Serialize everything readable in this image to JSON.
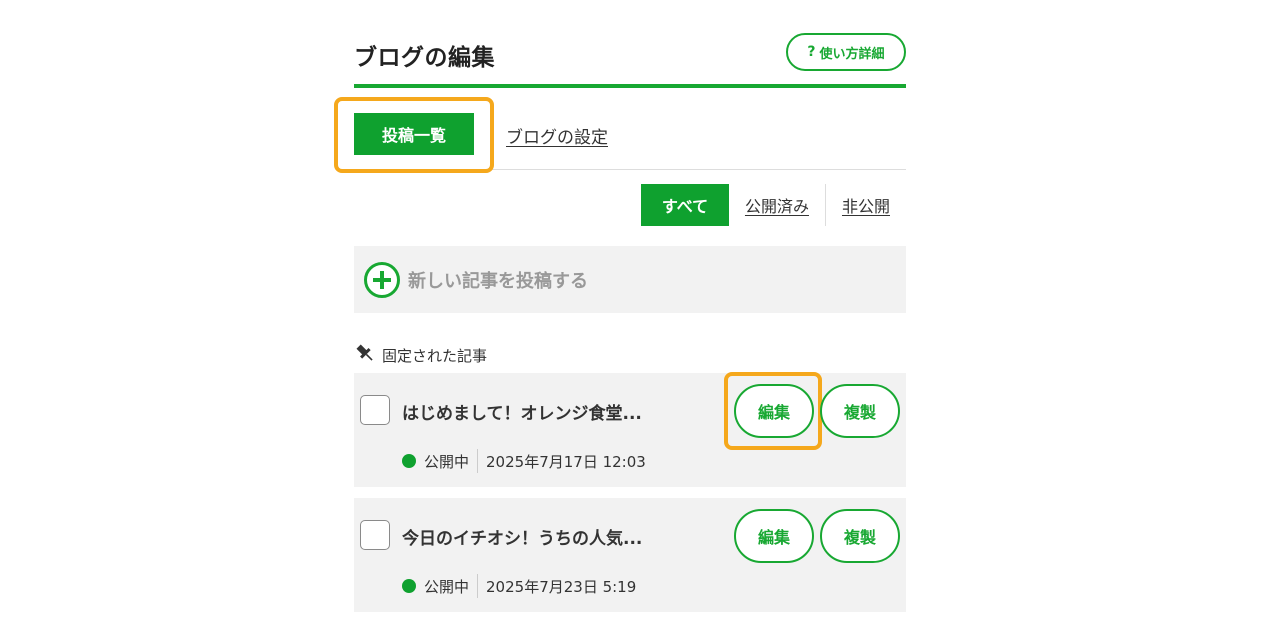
{
  "header": {
    "title": "ブログの編集",
    "help_label": "使い方詳細",
    "help_icon": "?"
  },
  "tabs": {
    "active": "投稿一覧",
    "other": "ブログの設定"
  },
  "filters": {
    "all": "すべて",
    "published": "公開済み",
    "private": "非公開"
  },
  "new_post": {
    "label": "新しい記事を投稿する"
  },
  "pinned": {
    "label": "固定された記事"
  },
  "posts": [
    {
      "title": "はじめまして！オレンジ食堂...",
      "status": "公開中",
      "date": "2025年7月17日 12:03",
      "edit_label": "編集",
      "copy_label": "複製"
    },
    {
      "title": "今日のイチオシ！うちの人気...",
      "status": "公開中",
      "date": "2025年7月23日 5:19",
      "edit_label": "編集",
      "copy_label": "複製"
    }
  ],
  "colors": {
    "accent": "#18a832",
    "accent_fill": "#0fa12f",
    "highlight": "#f5a81c",
    "row_bg": "#f2f2f2"
  }
}
